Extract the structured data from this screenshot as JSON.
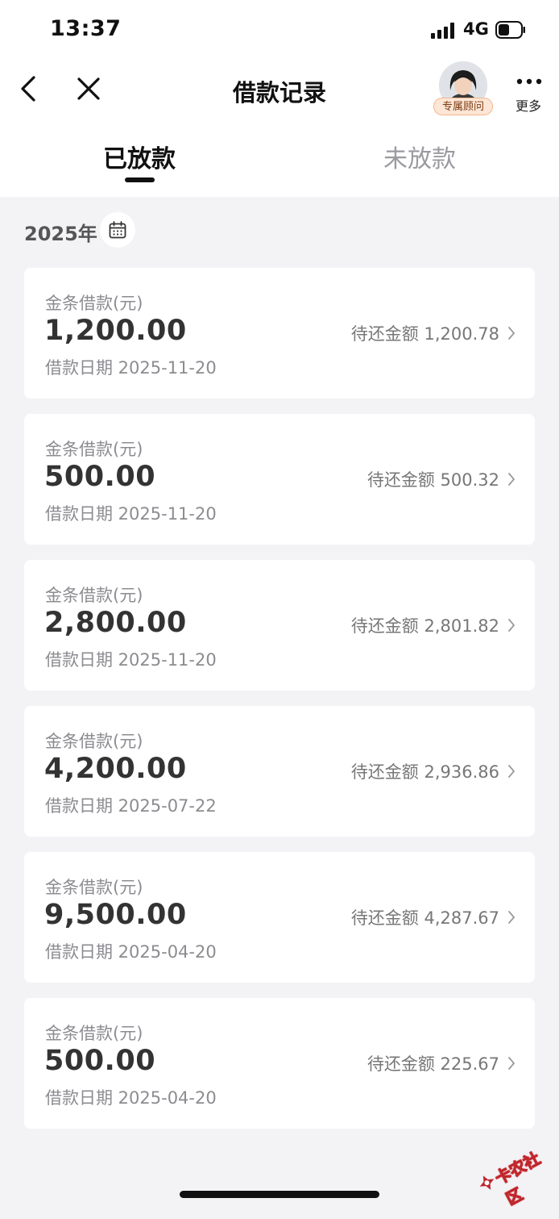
{
  "status_bar": {
    "time": "13:37",
    "network": "4G"
  },
  "header": {
    "title": "借款记录",
    "advisor_badge": "专属顾问",
    "more_label": "更多"
  },
  "tabs": [
    {
      "label": "已放款",
      "active": true
    },
    {
      "label": "未放款",
      "active": false
    }
  ],
  "year_filter": "2025年",
  "loans": [
    {
      "label": "金条借款(元)",
      "amount": "1,200.00",
      "date": "借款日期 2025-11-20",
      "remaining": "待还金额 1,200.78"
    },
    {
      "label": "金条借款(元)",
      "amount": "500.00",
      "date": "借款日期 2025-11-20",
      "remaining": "待还金额 500.32"
    },
    {
      "label": "金条借款(元)",
      "amount": "2,800.00",
      "date": "借款日期 2025-11-20",
      "remaining": "待还金额 2,801.82"
    },
    {
      "label": "金条借款(元)",
      "amount": "4,200.00",
      "date": "借款日期 2025-07-22",
      "remaining": "待还金额 2,936.86"
    },
    {
      "label": "金条借款(元)",
      "amount": "9,500.00",
      "date": "借款日期 2025-04-20",
      "remaining": "待还金额 4,287.67"
    },
    {
      "label": "金条借款(元)",
      "amount": "500.00",
      "date": "借款日期 2025-04-20",
      "remaining": "待还金额 225.67"
    }
  ],
  "watermark": "卡农社区",
  "colors": {
    "background": "#f3f3f6",
    "card": "#ffffff",
    "badge_bg": "#fde6d5",
    "watermark": "#c0262b"
  }
}
